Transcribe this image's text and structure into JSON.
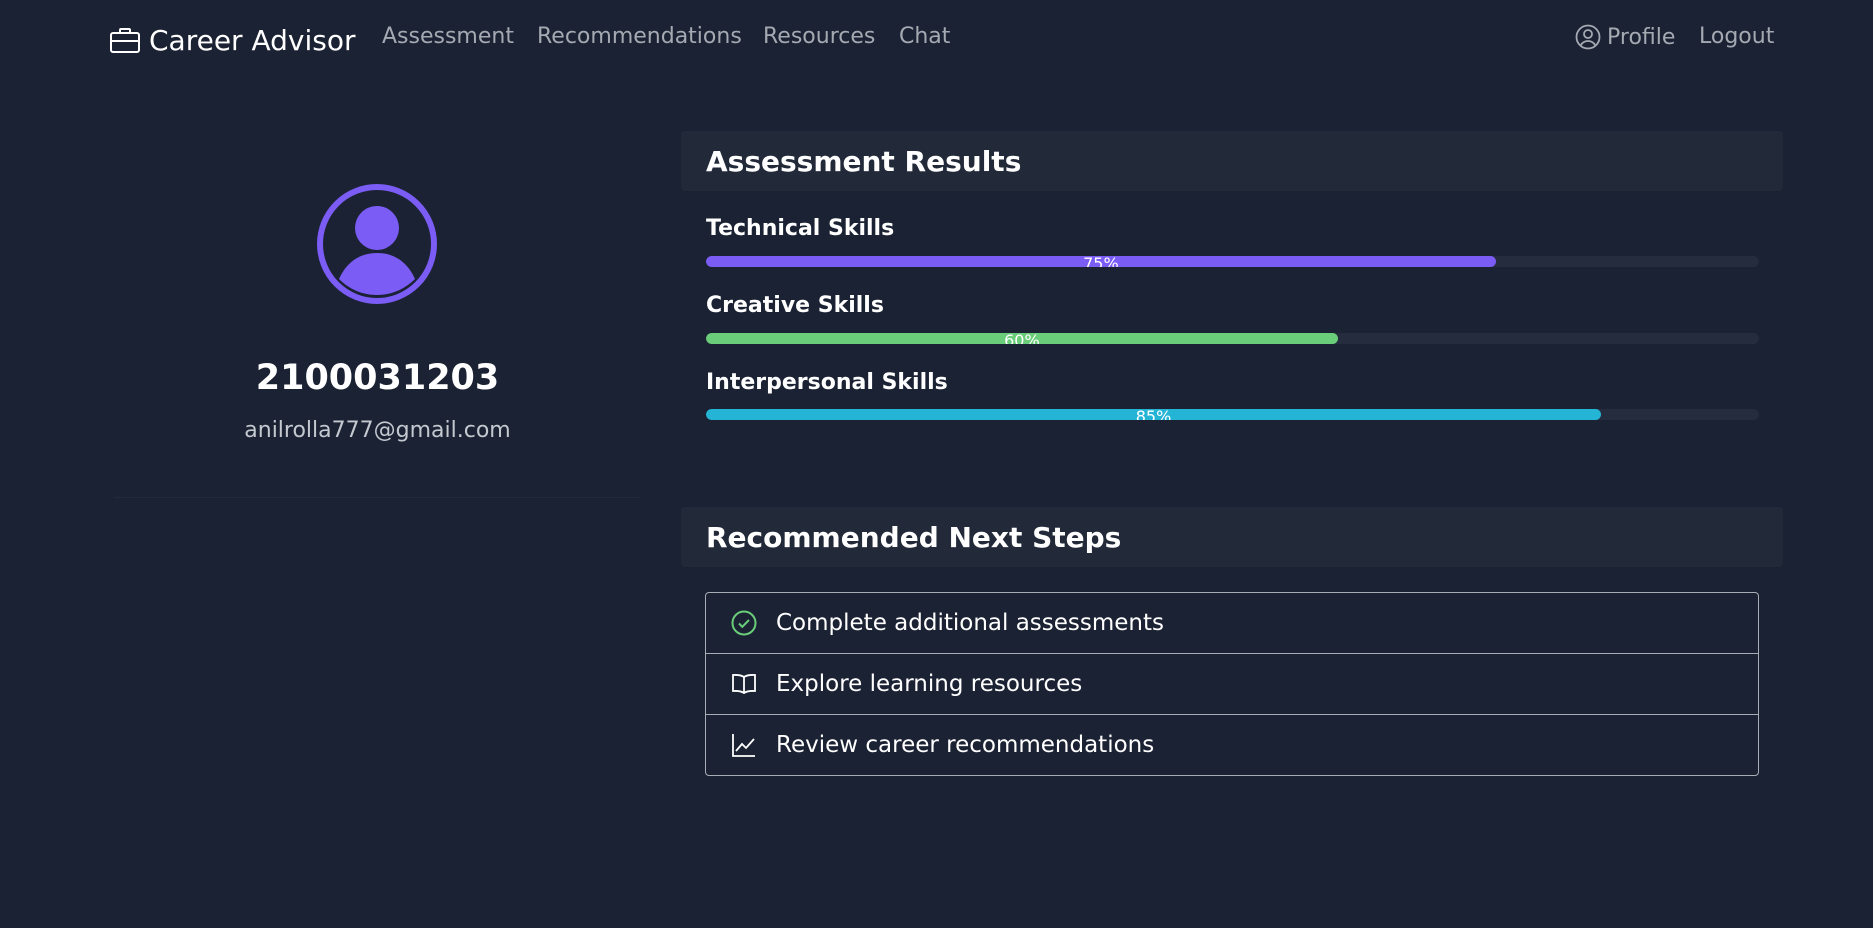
{
  "nav": {
    "brand": "Career Advisor",
    "links": [
      "Assessment",
      "Recommendations",
      "Resources",
      "Chat"
    ],
    "profile": "Profile",
    "logout": "Logout"
  },
  "profile": {
    "username": "2100031203",
    "email": "anilrolla777@gmail.com"
  },
  "assessment": {
    "title": "Assessment Results",
    "skills": [
      {
        "label": "Technical Skills",
        "value": 75,
        "text": "75%",
        "color": "#7b5cf5"
      },
      {
        "label": "Creative Skills",
        "value": 60,
        "text": "60%",
        "color": "#69cd7a"
      },
      {
        "label": "Interpersonal Skills",
        "value": 85,
        "text": "85%",
        "color": "#24b5d6"
      }
    ]
  },
  "next_steps": {
    "title": "Recommended Next Steps",
    "items": [
      {
        "label": "Complete additional assessments",
        "icon": "check-circle-icon"
      },
      {
        "label": "Explore learning resources",
        "icon": "book-icon"
      },
      {
        "label": "Review career recommendations",
        "icon": "chart-line-icon"
      }
    ]
  },
  "colors": {
    "background": "#1b2233",
    "accent": "#7b5cf5"
  }
}
